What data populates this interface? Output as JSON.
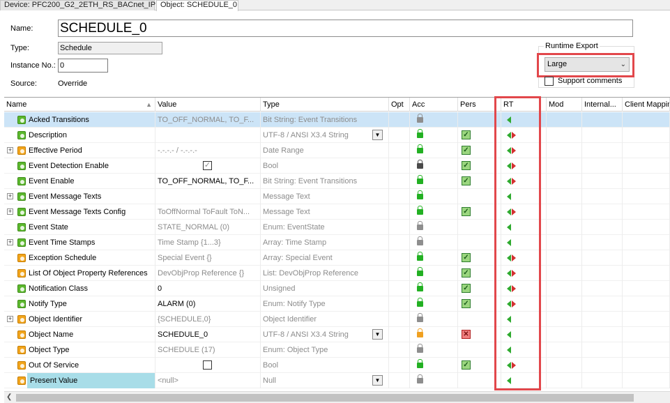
{
  "tabs": [
    {
      "label": "Device: PFC200_G2_2ETH_RS_BACnet_IP"
    },
    {
      "label": "Object: SCHEDULE_0"
    }
  ],
  "form": {
    "name_label": "Name:",
    "name_value": "SCHEDULE_0",
    "type_label": "Type:",
    "type_value": "Schedule",
    "instance_label": "Instance No.:",
    "instance_value": "0",
    "source_label": "Source:",
    "source_value": "Override"
  },
  "runtime_export": {
    "title": "Runtime Export",
    "selected": "Large",
    "support_comments_label": "Support comments",
    "support_comments_checked": false
  },
  "grid": {
    "columns": [
      "Name",
      "Value",
      "Type",
      "Opt",
      "Acc",
      "Pers",
      "RT",
      "Mod",
      "Internal...",
      "Client Mappin"
    ],
    "rows": [
      {
        "name": "Acked Transitions",
        "value": "TO_OFF_NORMAL, TO_F...",
        "type": "Bit String: Event Transitions",
        "icon": "property-green-icon",
        "expander": false,
        "acc": "gray",
        "pers": "",
        "rt": "left"
      },
      {
        "name": "Description",
        "value": "",
        "type": "UTF-8 / ANSI X3.4 String",
        "icon": "property-green-icon",
        "expander": false,
        "acc": "green",
        "pers": "green",
        "rt": "both"
      },
      {
        "name": "Effective Period",
        "value": "-.-.-.- / -.-.-.-",
        "type": "Date Range",
        "icon": "property-orange-icon",
        "expander": true,
        "acc": "green",
        "pers": "green",
        "rt": "both"
      },
      {
        "name": "Event Detection Enable",
        "value": "",
        "type": "Bool",
        "icon": "property-green-icon",
        "expander": false,
        "acc": "dark",
        "pers": "green",
        "rt": "both"
      },
      {
        "name": "Event Enable",
        "value": "TO_OFF_NORMAL, TO_F...",
        "type": "Bit String: Event Transitions",
        "icon": "property-green-icon",
        "expander": false,
        "acc": "green",
        "pers": "green",
        "rt": "both"
      },
      {
        "name": "Event Message Texts",
        "value": "",
        "type": "Message Text",
        "icon": "property-green-icon",
        "expander": true,
        "acc": "green",
        "pers": "",
        "rt": "left"
      },
      {
        "name": "Event Message Texts Config",
        "value": "ToOffNormal ToFault ToN...",
        "type": "Message Text",
        "icon": "property-green-icon",
        "expander": true,
        "acc": "green",
        "pers": "green",
        "rt": "both"
      },
      {
        "name": "Event State",
        "value": "STATE_NORMAL (0)",
        "type": "Enum: EventState",
        "icon": "property-green-icon",
        "expander": false,
        "acc": "gray",
        "pers": "",
        "rt": "left"
      },
      {
        "name": "Event Time Stamps",
        "value": "Time Stamp {1...3}",
        "type": "Array: Time Stamp",
        "icon": "property-green-icon",
        "expander": true,
        "acc": "gray",
        "pers": "",
        "rt": "left"
      },
      {
        "name": "Exception Schedule",
        "value": "Special Event {}",
        "type": "Array: Special Event",
        "icon": "property-orange-icon",
        "expander": false,
        "acc": "green",
        "pers": "green",
        "rt": "both"
      },
      {
        "name": "List Of Object Property References",
        "value": "DevObjProp Reference {}",
        "type": "List: DevObjProp Reference",
        "icon": "property-orange-icon",
        "expander": false,
        "acc": "green",
        "pers": "green",
        "rt": "both"
      },
      {
        "name": "Notification Class",
        "value": "0",
        "type": "Unsigned",
        "icon": "property-green-icon",
        "expander": false,
        "acc": "green",
        "pers": "green",
        "rt": "both"
      },
      {
        "name": "Notify Type",
        "value": "ALARM (0)",
        "type": "Enum: Notify Type",
        "icon": "property-green-icon",
        "expander": false,
        "acc": "green",
        "pers": "green",
        "rt": "both"
      },
      {
        "name": "Object Identifier",
        "value": "{SCHEDULE,0}",
        "type": "Object Identifier",
        "icon": "property-orange-icon",
        "expander": true,
        "acc": "gray",
        "pers": "",
        "rt": "left"
      },
      {
        "name": "Object Name",
        "value": "SCHEDULE_0",
        "type": "UTF-8 / ANSI X3.4 String",
        "icon": "property-orange-icon",
        "expander": false,
        "acc": "orange",
        "pers": "red",
        "rt": "left"
      },
      {
        "name": "Object Type",
        "value": "SCHEDULE (17)",
        "type": "Enum: Object Type",
        "icon": "property-orange-icon",
        "expander": false,
        "acc": "gray",
        "pers": "",
        "rt": "left"
      },
      {
        "name": "Out Of Service",
        "value": "",
        "type": "Bool",
        "icon": "property-orange-icon",
        "expander": false,
        "acc": "green",
        "pers": "green",
        "rt": "both"
      },
      {
        "name": "Present Value",
        "value": "<null>",
        "type": "Null",
        "icon": "property-orange-icon",
        "expander": false,
        "acc": "gray",
        "pers": "",
        "rt": "left"
      }
    ]
  },
  "colors": {
    "highlight_red": "#e2474b",
    "selected_row": "#cce4f7",
    "present_value_highlight": "#a8dde8"
  }
}
